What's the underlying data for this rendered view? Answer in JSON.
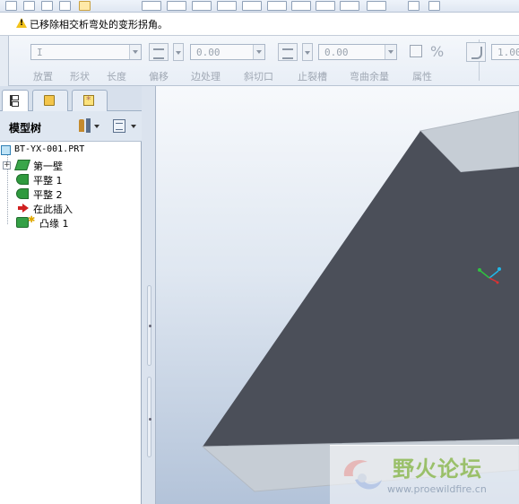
{
  "message_line": {
    "text": "已移除相交析弯处的变形拐角。",
    "icon": "warning-icon"
  },
  "dashboard": {
    "type_value": "I",
    "offset_value": "0.00",
    "relief_value": "0.00",
    "bend_value": "1.00",
    "tabs": [
      "放置",
      "形状",
      "长度",
      "偏移",
      "边处理",
      "斜切口",
      "止裂槽",
      "弯曲余量",
      "属性"
    ]
  },
  "navigator": {
    "tabs": [
      {
        "name": "model-tree-tab",
        "icon": "tree-icon"
      },
      {
        "name": "folder-browser-tab",
        "icon": "folder-icon"
      },
      {
        "name": "favorites-tab",
        "icon": "favorites-icon"
      }
    ]
  },
  "model_tree": {
    "title": "模型树",
    "settings_icon": "tree-settings-icon",
    "show_icon": "tree-show-icon",
    "items": [
      {
        "label": "BT-YX-001.PRT",
        "icon": "part-icon"
      },
      {
        "label": "第一壁",
        "icon": "first-wall-icon"
      },
      {
        "label": "平整 1",
        "icon": "flat-wall-icon"
      },
      {
        "label": "平整 2",
        "icon": "flat-wall-icon"
      },
      {
        "label": "在此插入",
        "icon": "insert-here-icon"
      },
      {
        "label": "凸缘 1",
        "icon": "flange-wall-icon"
      }
    ]
  },
  "viewport": {
    "background_top": "#f7f9fc",
    "background_bottom": "#b3c3d9",
    "face_color": "#4b4f59",
    "edge_color": "#c6cdd5",
    "csys_icon": "coordinate-system-icon"
  },
  "watermark": {
    "title": "野火论坛",
    "url": "www.proewildfire.cn"
  }
}
